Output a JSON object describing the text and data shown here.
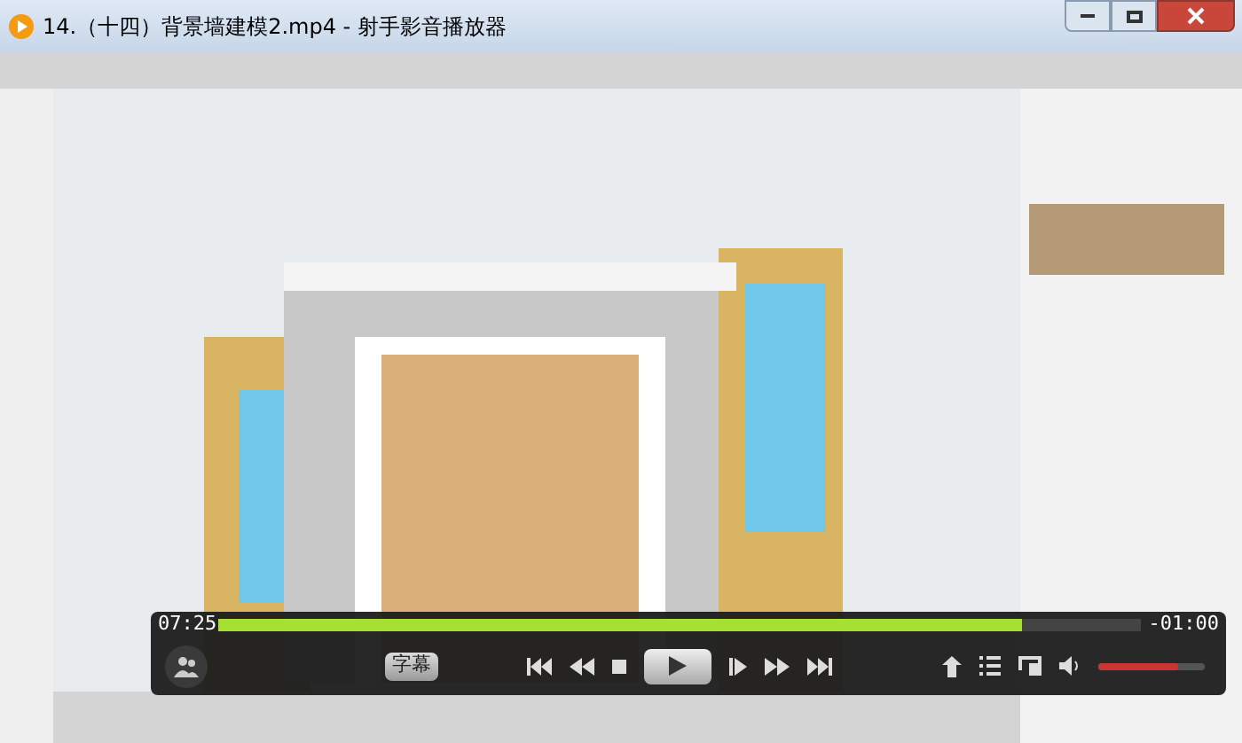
{
  "window": {
    "title": "14.（十四）背景墙建模2.mp4 - 射手影音播放器"
  },
  "player": {
    "elapsed": "07:25",
    "remaining": "-01:00",
    "progress": {
      "level": 0.87
    },
    "subtitle_button": "字幕",
    "volume": {
      "level": 0.75
    }
  }
}
